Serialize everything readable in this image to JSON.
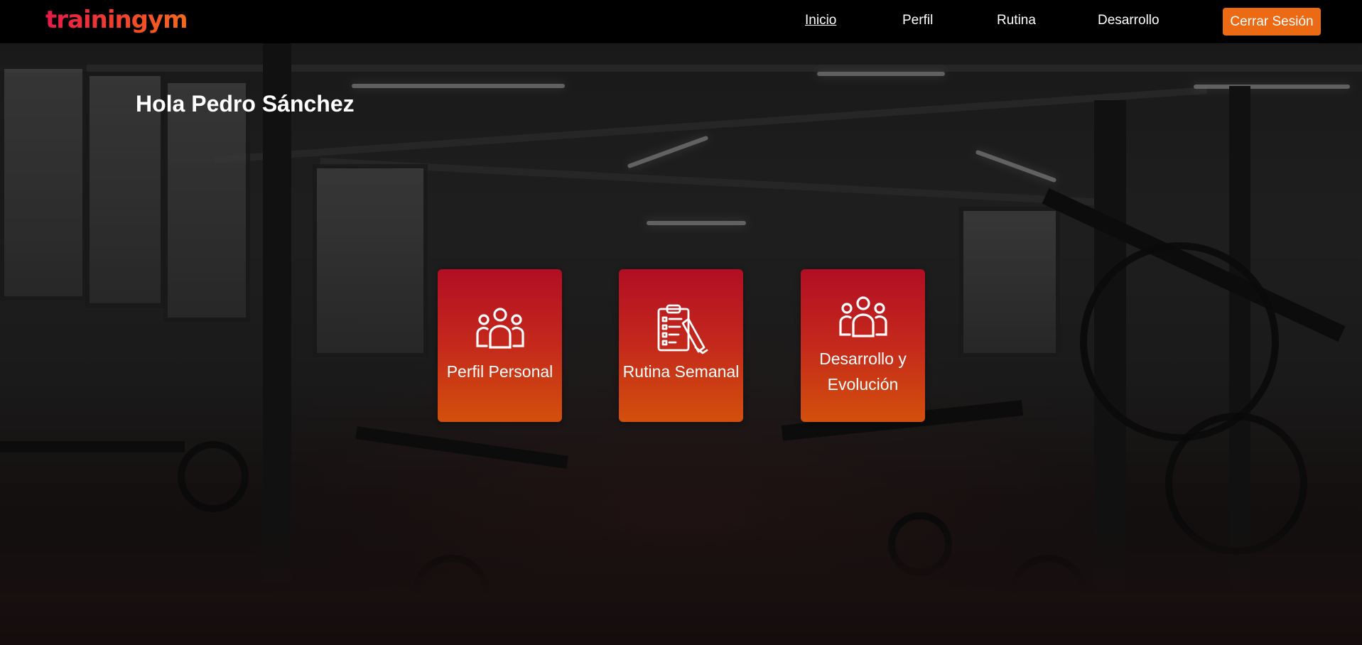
{
  "brand": {
    "logo_text": "trainingym"
  },
  "nav": {
    "items": [
      {
        "label": "Inicio",
        "active": true
      },
      {
        "label": "Perfil",
        "active": false
      },
      {
        "label": "Rutina",
        "active": false
      },
      {
        "label": "Desarrollo",
        "active": false
      }
    ],
    "logout_label": "Cerrar Sesión"
  },
  "main": {
    "greeting": "Hola Pedro Sánchez",
    "cards": [
      {
        "label": "Perfil Personal",
        "icon": "people-group-icon"
      },
      {
        "label": "Rutina Semanal",
        "icon": "clipboard-checklist-icon"
      },
      {
        "label": "Desarrollo y Evolución",
        "icon": "people-group-icon"
      }
    ]
  },
  "colors": {
    "header_bg": "#000000",
    "accent_orange": "#ec6a14",
    "card_gradient_top": "#b20e24",
    "card_gradient_bottom": "#d3500c",
    "logo_gradient_start": "#e8194a",
    "logo_gradient_end": "#f46a1d"
  }
}
